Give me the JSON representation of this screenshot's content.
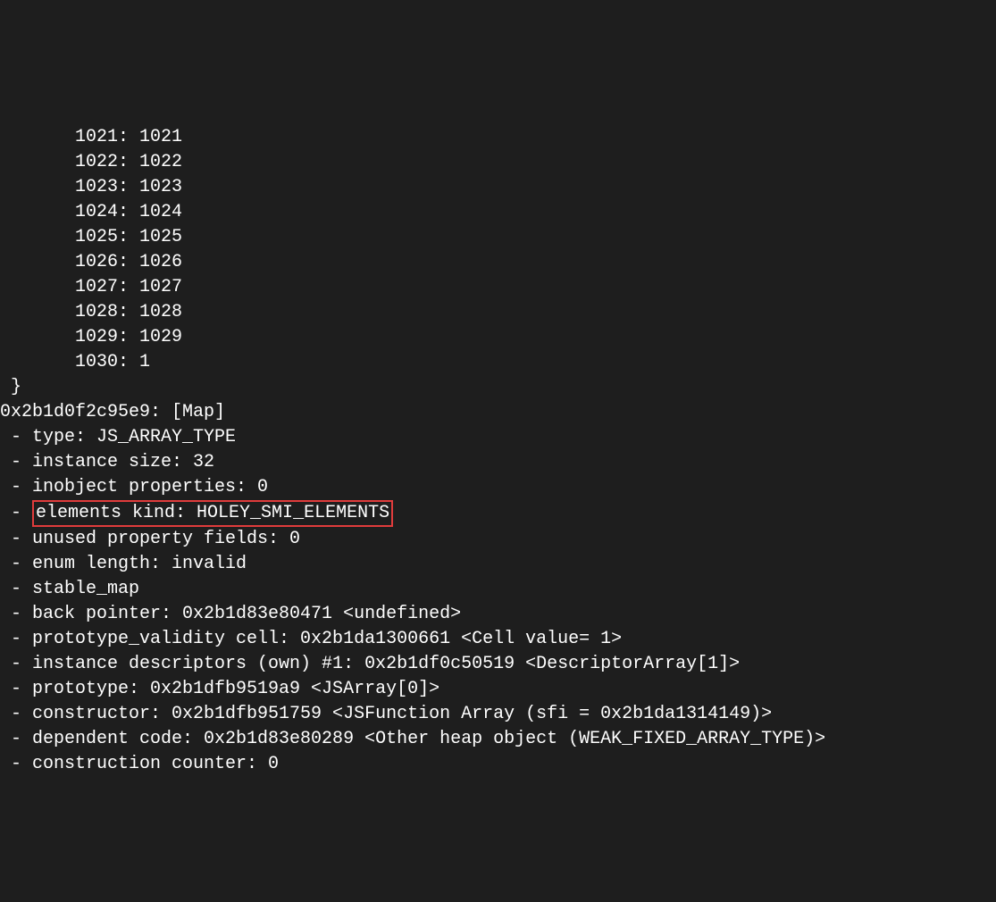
{
  "debug_output": {
    "partial_top_line": "       1021: 1021",
    "array_entries": [
      {
        "index": "1022",
        "value": "1022"
      },
      {
        "index": "1023",
        "value": "1023"
      },
      {
        "index": "1024",
        "value": "1024"
      },
      {
        "index": "1025",
        "value": "1025"
      },
      {
        "index": "1026",
        "value": "1026"
      },
      {
        "index": "1027",
        "value": "1027"
      },
      {
        "index": "1028",
        "value": "1028"
      },
      {
        "index": "1029",
        "value": "1029"
      },
      {
        "index": "1030",
        "value": "1"
      }
    ],
    "closing_brace": " }",
    "map_header": "0x2b1d0f2c95e9: [Map]",
    "map_details": [
      {
        "text": "type: JS_ARRAY_TYPE",
        "highlighted": false
      },
      {
        "text": "instance size: 32",
        "highlighted": false
      },
      {
        "text": "inobject properties: 0",
        "highlighted": false
      },
      {
        "text": "elements kind: HOLEY_SMI_ELEMENTS",
        "highlighted": true
      },
      {
        "text": "unused property fields: 0",
        "highlighted": false
      },
      {
        "text": "enum length: invalid",
        "highlighted": false
      },
      {
        "text": "stable_map",
        "highlighted": false
      },
      {
        "text": "back pointer: 0x2b1d83e80471 <undefined>",
        "highlighted": false
      },
      {
        "text": "prototype_validity cell: 0x2b1da1300661 <Cell value= 1>",
        "highlighted": false
      },
      {
        "text": "instance descriptors (own) #1: 0x2b1df0c50519 <DescriptorArray[1]>",
        "highlighted": false
      },
      {
        "text": "prototype: 0x2b1dfb9519a9 <JSArray[0]>",
        "highlighted": false
      },
      {
        "text": "constructor: 0x2b1dfb951759 <JSFunction Array (sfi = 0x2b1da1314149)>",
        "highlighted": false
      },
      {
        "text": "dependent code: 0x2b1d83e80289 <Other heap object (WEAK_FIXED_ARRAY_TYPE)>",
        "highlighted": false
      },
      {
        "text": "construction counter: 0",
        "highlighted": false
      }
    ]
  }
}
